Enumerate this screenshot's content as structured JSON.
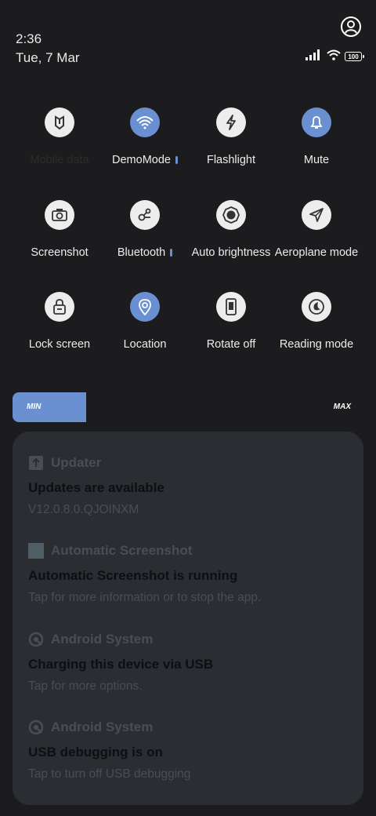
{
  "status_bar": {
    "time": "2:36",
    "date": "Tue, 7 Mar",
    "battery": "100",
    "icons": [
      "signal-icon",
      "wifi-icon",
      "battery-icon"
    ]
  },
  "quick_settings": {
    "tiles": [
      {
        "label": "Mobile data",
        "state": "off",
        "icon": "mobile-data-icon"
      },
      {
        "label": "DemoMode",
        "state": "on",
        "icon": "wifi-icon",
        "indicator": true
      },
      {
        "label": "Flashlight",
        "state": "off",
        "icon": "flashlight-icon"
      },
      {
        "label": "Mute",
        "state": "on",
        "icon": "bell-icon"
      },
      {
        "label": "Screenshot",
        "state": "off",
        "icon": "camera-icon"
      },
      {
        "label": "Bluetooth",
        "state": "off",
        "icon": "bluetooth-icon",
        "indicator": true
      },
      {
        "label": "Auto brightness",
        "state": "off",
        "icon": "brightness-icon"
      },
      {
        "label": "Aeroplane mode",
        "state": "off",
        "icon": "airplane-icon"
      },
      {
        "label": "Lock screen",
        "state": "off",
        "icon": "lock-icon"
      },
      {
        "label": "Location",
        "state": "on",
        "icon": "location-icon"
      },
      {
        "label": "Rotate off",
        "state": "off",
        "icon": "rotate-icon"
      },
      {
        "label": "Reading mode",
        "state": "off",
        "icon": "reading-mode-icon"
      }
    ]
  },
  "brightness": {
    "min_label": "MIN",
    "max_label": "MAX",
    "level": 0.21
  },
  "notifications": [
    {
      "app": "Updater",
      "title": "Updates are available",
      "body": "V12.0.8.0.QJOINXM",
      "icon": "upload-icon"
    },
    {
      "app": "Automatic Screenshot",
      "title": "Automatic Screenshot is running",
      "body": "Tap for more information or to stop the app.",
      "icon": "app-square-icon"
    },
    {
      "app": "Android System",
      "title": "Charging this device via USB",
      "body": "Tap for more options.",
      "icon": "android-system-icon"
    },
    {
      "app": "Android System",
      "title": "USB debugging is on",
      "body": "Tap to turn off USB debugging",
      "icon": "android-system-icon"
    }
  ],
  "colors": {
    "accent": "#6a90d2",
    "background": "#1c1c1e",
    "panel": "#2a2d31"
  }
}
